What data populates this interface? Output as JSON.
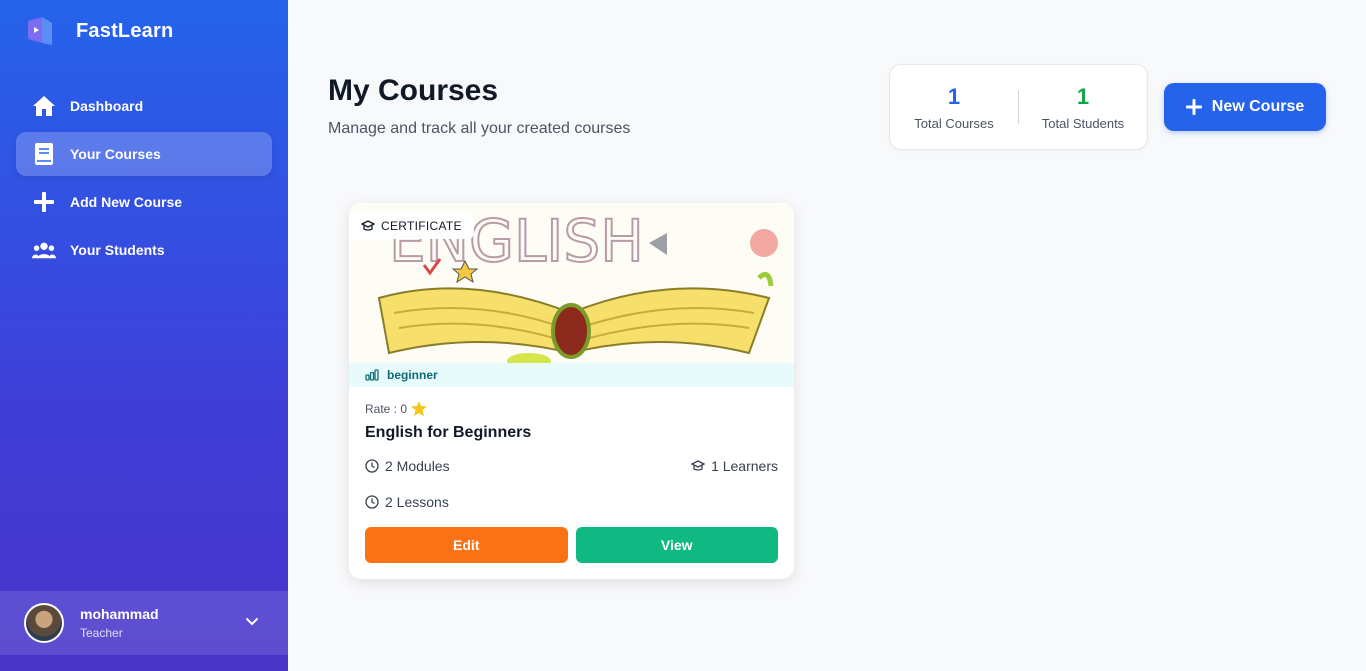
{
  "app": {
    "name": "FastLearn"
  },
  "sidebar": {
    "items": [
      {
        "label": "Dashboard",
        "icon": "home-icon"
      },
      {
        "label": "Your Courses",
        "icon": "book-icon",
        "active": true
      },
      {
        "label": "Add New Course",
        "icon": "plus-icon"
      },
      {
        "label": "Your Students",
        "icon": "users-icon"
      }
    ],
    "user": {
      "name": "mohammad",
      "role": "Teacher"
    }
  },
  "header": {
    "title": "My Courses",
    "subtitle": "Manage and track all your created courses"
  },
  "stats": [
    {
      "value": "1",
      "label": "Total Courses",
      "color": "#2563eb"
    },
    {
      "value": "1",
      "label": "Total Students",
      "color": "#16a34a"
    }
  ],
  "new_course_label": "New Course",
  "courses": [
    {
      "badge": "CERTIFICATE",
      "level": "beginner",
      "rate_label": "Rate : 0",
      "title": "English for Beginners",
      "modules": "2 Modules",
      "learners": "1 Learners",
      "lessons": "2 Lessons",
      "edit_label": "Edit",
      "view_label": "View",
      "image_text": "ENGLISH"
    }
  ],
  "colors": {
    "accent": "#2563eb",
    "edit": "#f97316",
    "view": "#10b981"
  }
}
